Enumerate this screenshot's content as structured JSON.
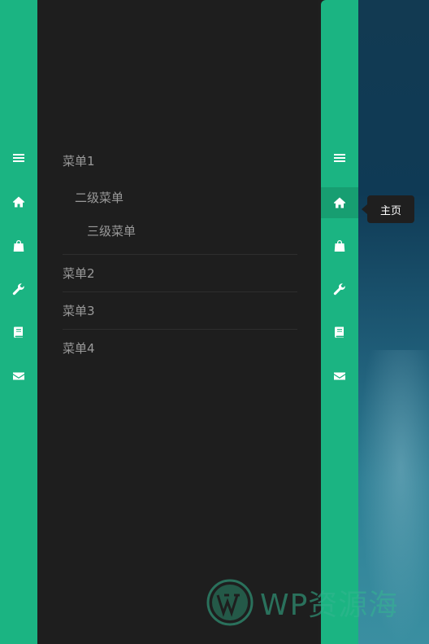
{
  "colors": {
    "accent": "#1bb482",
    "panel": "#1e1e1e",
    "menu_text": "#9a9a9a",
    "tooltip_bg": "#1f1f1f"
  },
  "left_rail": {
    "icons": [
      "menu-icon",
      "home-icon",
      "shopping-bag-icon",
      "wrench-icon",
      "book-icon",
      "envelope-icon"
    ]
  },
  "menu": {
    "items": [
      {
        "label": "菜单1",
        "level": 1
      },
      {
        "label": "二级菜单",
        "level": 2
      },
      {
        "label": "三级菜单",
        "level": 3
      },
      {
        "label": "菜单2",
        "level": 1
      },
      {
        "label": "菜单3",
        "level": 1
      },
      {
        "label": "菜单4",
        "level": 1
      }
    ]
  },
  "right_rail": {
    "icons": [
      "menu-icon",
      "home-icon",
      "shopping-bag-icon",
      "wrench-icon",
      "book-icon",
      "envelope-icon"
    ],
    "active_icon": "home-icon"
  },
  "tooltip": {
    "text": "主页"
  },
  "watermark": {
    "text": "WP资源海"
  }
}
